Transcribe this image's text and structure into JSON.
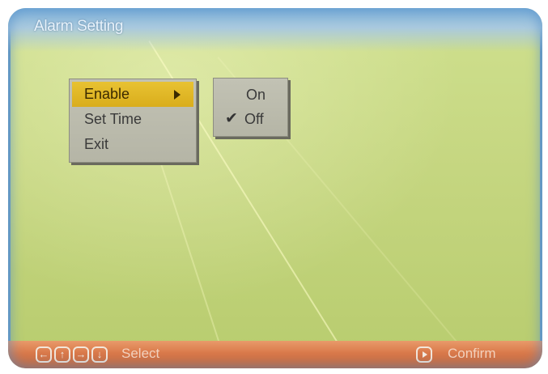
{
  "header": {
    "title": "Alarm Setting"
  },
  "menu": {
    "items": [
      {
        "label": "Enable",
        "selected": true,
        "has_submenu": true
      },
      {
        "label": "Set Time",
        "selected": false,
        "has_submenu": false
      },
      {
        "label": "Exit",
        "selected": false,
        "has_submenu": false
      }
    ]
  },
  "submenu": {
    "options": [
      {
        "label": "On",
        "checked": false
      },
      {
        "label": "Off",
        "checked": true
      }
    ],
    "check_glyph": "✔"
  },
  "footer": {
    "nav_icons": [
      "left-arrow-icon",
      "up-arrow-icon",
      "right-arrow-icon",
      "down-arrow-icon"
    ],
    "select_label": "Select",
    "confirm_icon": "play-icon",
    "confirm_label": "Confirm"
  },
  "colors": {
    "highlight": "#d9ad1c",
    "bottom_bar": "#d9794a",
    "title_bar": "#7fb2da",
    "background": "#c5d680"
  }
}
